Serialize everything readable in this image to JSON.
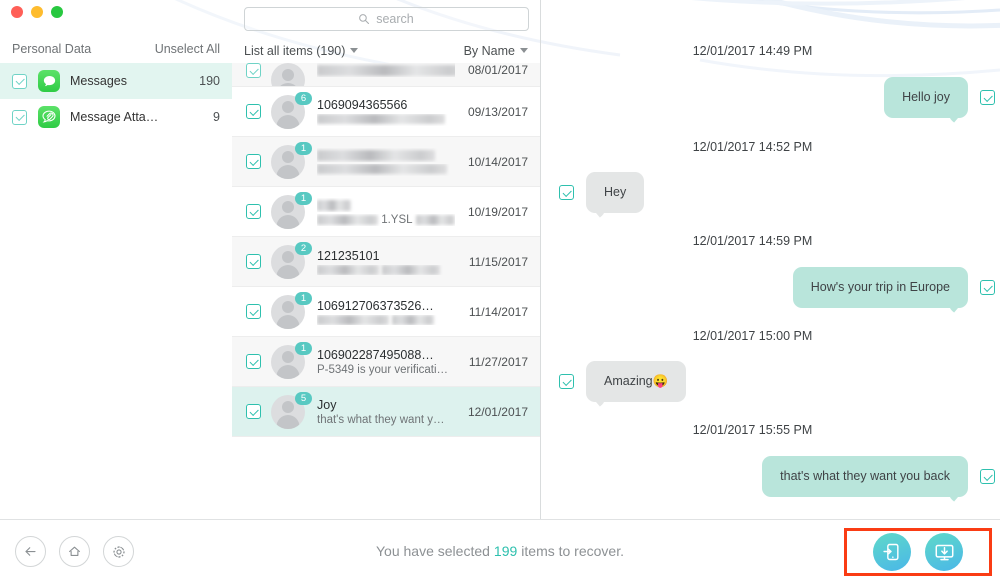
{
  "window": {
    "traffic_lights": [
      "close",
      "minimize",
      "zoom"
    ]
  },
  "sidebar": {
    "title": "Personal Data",
    "unselect_label": "Unselect All",
    "items": [
      {
        "label": "Messages",
        "count": "190",
        "icon": "messages-icon",
        "selected": true,
        "checked": true
      },
      {
        "label": "Message Atta…",
        "count": "9",
        "icon": "message-attachments-icon",
        "selected": false,
        "checked": true
      }
    ]
  },
  "list_panel": {
    "search": {
      "placeholder": "search",
      "value": "",
      "icon": "search-icon"
    },
    "filter_label": "List all items (190)",
    "sort_label": "By Name",
    "rows": [
      {
        "title": "",
        "subtitle": "",
        "date": "08/01/2017",
        "badge": "",
        "checked": true,
        "redacted_title": true,
        "redacted_sub": true,
        "partial": true
      },
      {
        "title": "1069094365566",
        "subtitle": "",
        "date": "09/13/2017",
        "badge": "6",
        "checked": true,
        "redacted_title": false,
        "redacted_sub": true
      },
      {
        "title": "",
        "subtitle": "",
        "date": "10/14/2017",
        "badge": "1",
        "checked": true,
        "redacted_title": true,
        "redacted_sub": true
      },
      {
        "title": "",
        "subtitle": "1.YSL",
        "date": "10/19/2017",
        "badge": "1",
        "checked": true,
        "redacted_title": true,
        "redacted_sub": "mixed"
      },
      {
        "title": "121235101",
        "subtitle": "",
        "date": "11/15/2017",
        "badge": "2",
        "checked": true,
        "redacted_title": false,
        "redacted_sub": true
      },
      {
        "title": "106912706373526…",
        "subtitle": "",
        "date": "11/14/2017",
        "badge": "1",
        "checked": true,
        "redacted_title": false,
        "redacted_sub": true
      },
      {
        "title": "106902287495088…",
        "subtitle": "P-5349 is your verificati…",
        "date": "11/27/2017",
        "badge": "1",
        "checked": true,
        "redacted_title": false,
        "redacted_sub": false
      },
      {
        "title": "Joy",
        "subtitle": "that's what they want y…",
        "date": "12/01/2017",
        "badge": "5",
        "checked": true,
        "redacted_title": false,
        "redacted_sub": false,
        "selected": true
      }
    ]
  },
  "conversation": {
    "messages": [
      {
        "time": "12/01/2017 14:49 PM",
        "text": "Hello joy",
        "side": "out",
        "checked": true
      },
      {
        "time": "12/01/2017 14:52 PM",
        "text": "Hey",
        "side": "in",
        "checked": true
      },
      {
        "time": "12/01/2017 14:59 PM",
        "text": "How's your trip in Europe",
        "side": "out",
        "checked": true
      },
      {
        "time": "12/01/2017 15:00 PM",
        "text": "Amazing😛",
        "side": "in",
        "checked": true
      },
      {
        "time": "12/01/2017 15:55 PM",
        "text": "that's what they want you back",
        "side": "out",
        "checked": true
      }
    ]
  },
  "bottom_bar": {
    "back_icon": "back-arrow-icon",
    "home_icon": "home-icon",
    "settings_icon": "gear-icon",
    "status_prefix": "You have selected",
    "status_count": "199",
    "status_suffix": "items to recover.",
    "recover_to_device_icon": "recover-to-device-icon",
    "recover_to_computer_icon": "recover-to-computer-icon",
    "highlight_color": "#fa3c14",
    "accent_color": "#2ec0ae"
  }
}
